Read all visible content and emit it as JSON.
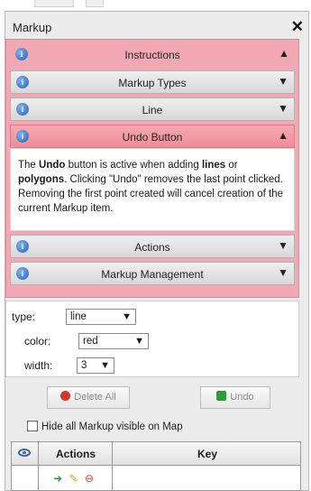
{
  "window": {
    "title": "Markup",
    "close_glyph": "✕"
  },
  "accordion": {
    "sections": [
      {
        "label": "Instructions",
        "icon": "info-icon",
        "state": "expanded-top",
        "chevron": "⌃"
      },
      {
        "label": "Markup Types",
        "icon": "info-icon",
        "state": "collapsed",
        "chevron": "⌄"
      },
      {
        "label": "Line",
        "icon": "info-icon",
        "state": "collapsed",
        "chevron": "⌄"
      },
      {
        "label": "Undo Button",
        "icon": "info-icon",
        "state": "expanded",
        "chevron": "⌃"
      },
      {
        "label": "Actions",
        "icon": "info-icon",
        "state": "collapsed",
        "chevron": "⌄"
      },
      {
        "label": "Markup Management",
        "icon": "info-icon",
        "state": "collapsed",
        "chevron": "⌄"
      }
    ],
    "undo_content": {
      "p1": "The ",
      "b1": "Undo",
      "p2": " button is active when adding ",
      "b2": "lines",
      "p3": " or ",
      "b3": "polygons",
      "p4": ". Clicking \"Undo\" removes the last point clicked. Removing the first point created will cancel creation of the current Markup item."
    }
  },
  "form": {
    "type_label": "type:",
    "type_value": "line",
    "color_label": "color:",
    "color_value": "red",
    "width_label": "width:",
    "width_value": "3"
  },
  "buttons": {
    "delete_all": "Delete All",
    "undo": "Undo"
  },
  "hide_markup": {
    "label": "Hide all Markup visible on Map",
    "checked": false
  },
  "table": {
    "headers": [
      "",
      "Actions",
      "Key"
    ],
    "row_icons": [
      "arrow-right-icon",
      "pencil-icon",
      "delete-icon"
    ]
  },
  "colors": {
    "accent_pink": "#f3a9b3",
    "info_blue": "#2660b8",
    "delete_red": "#d9342b",
    "undo_green": "#2f9a3a"
  }
}
